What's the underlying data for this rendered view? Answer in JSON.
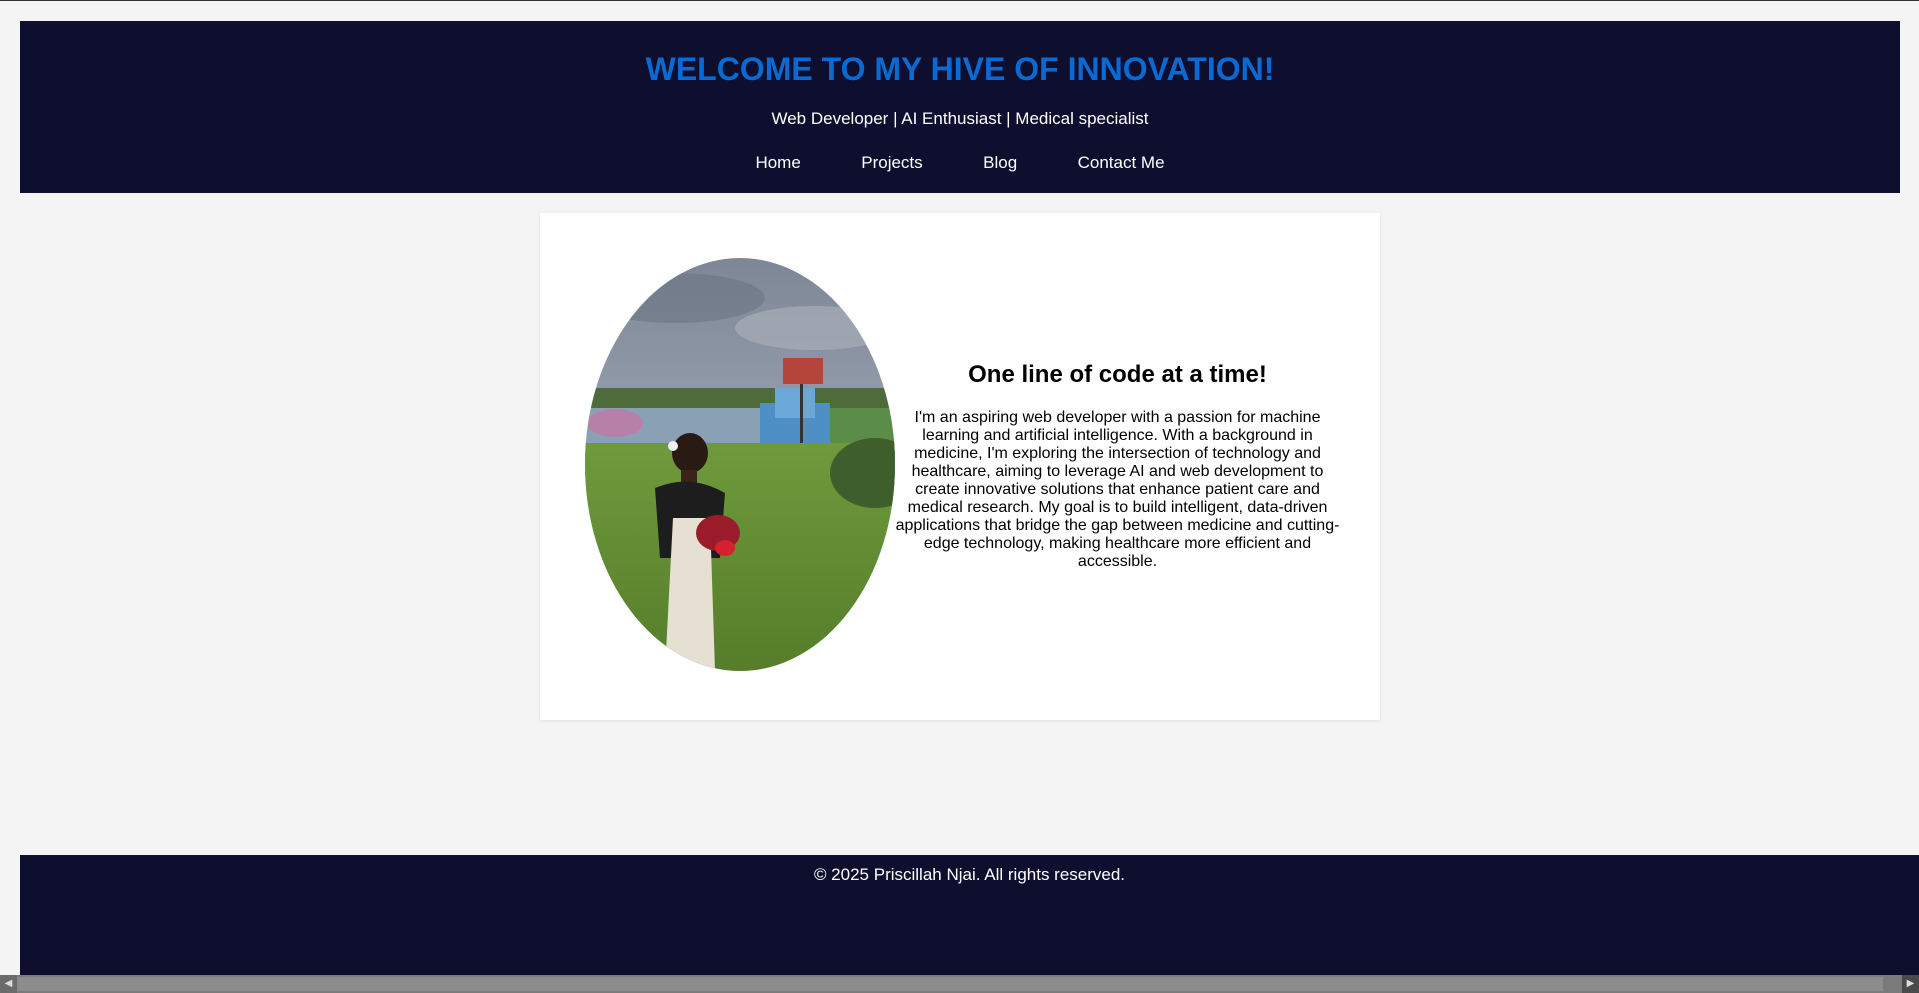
{
  "header": {
    "title": "WELCOME TO MY HIVE OF INNOVATION!",
    "tagline": "Web Developer | AI Enthusiast | Medical specialist",
    "nav": [
      {
        "label": "Home"
      },
      {
        "label": "Projects"
      },
      {
        "label": "Blog"
      },
      {
        "label": "Contact Me"
      }
    ]
  },
  "intro": {
    "heading": "One line of code at a time!",
    "body": "I'm an aspiring web developer with a passion for machine learning and artificial intelligence. With a background in medicine, I'm exploring the intersection of technology and healthcare, aiming to leverage AI and web development to create innovative solutions that enhance patient care and medical research. My goal is to build intelligent, data-driven applications that bridge the gap between medicine and cutting-edge technology, making healthcare more efficient and accessible."
  },
  "footer": {
    "copyright": "© 2025 Priscillah Njai. All rights reserved."
  },
  "colors": {
    "header_bg": "#0e0e2e",
    "title": "#0a6ad2",
    "page_bg": "#f4f4f4",
    "card_bg": "#ffffff"
  },
  "icons": {
    "scroll_left": "chevron-left-icon",
    "scroll_right": "chevron-right-icon"
  }
}
